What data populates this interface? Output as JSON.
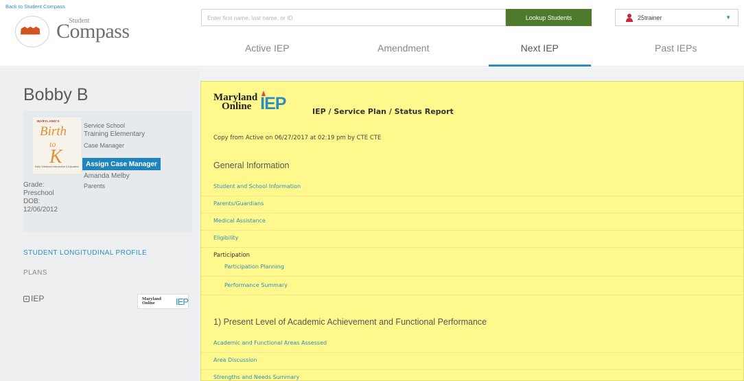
{
  "header": {
    "back_link": "Back to Student Compass",
    "logo_student": "Student",
    "logo_compass": "Compass",
    "search_placeholder": "Enter first name, last name, or ID",
    "lookup_button": "Lookup Students",
    "username": "25trainer"
  },
  "tabs": [
    {
      "label": "Active IEP"
    },
    {
      "label": "Amendment"
    },
    {
      "label": "Next IEP",
      "active": true
    },
    {
      "label": "Past IEPs"
    }
  ],
  "student": {
    "name": "Bobby B",
    "program_logo": {
      "top": "MARYLAND'S",
      "line1": "Birth",
      "line2": "to",
      "k": "K",
      "foot": "Early Childhood Intervention & Education"
    },
    "service_school_label": "Service School",
    "service_school": "Training Elementary",
    "case_manager_label": "Case Manager",
    "assign_button": "Assign Case Manager",
    "case_manager": "Amanda Melby",
    "parents_label": "Parents",
    "grade_label": "Grade:",
    "grade": "Preschool",
    "dob_label": "DOB:",
    "dob": "12/06/2012",
    "longitudinal_profile": "STUDENT LONGITUDINAL PROFILE",
    "plans_label": "PLANS",
    "iep_plan": "IEP",
    "mini_logo_md": "Maryland Online",
    "mini_logo_iep": "IEP"
  },
  "document": {
    "logo_line1": "Maryland",
    "logo_line2": "Online",
    "logo_iep": "IEP",
    "title": "IEP / Service Plan / Status Report",
    "copy_note": "Copy from Active on 06/27/2017 at 02:19 pm by CTE CTE",
    "general_heading": "General Information",
    "general_links": [
      "Student and School Information",
      "Parents/Guardians",
      "Medical Assistance",
      "Eligibility"
    ],
    "participation_label": "Participation",
    "participation_links": [
      "Participation Planning",
      "Performance Summary"
    ],
    "plaafp_heading": "1) Present Level of Academic Achievement and Functional Performance",
    "plaafp_links": [
      "Academic and Functional Areas Assessed",
      "Area Discussion",
      "Strengths and Needs Summary"
    ]
  }
}
